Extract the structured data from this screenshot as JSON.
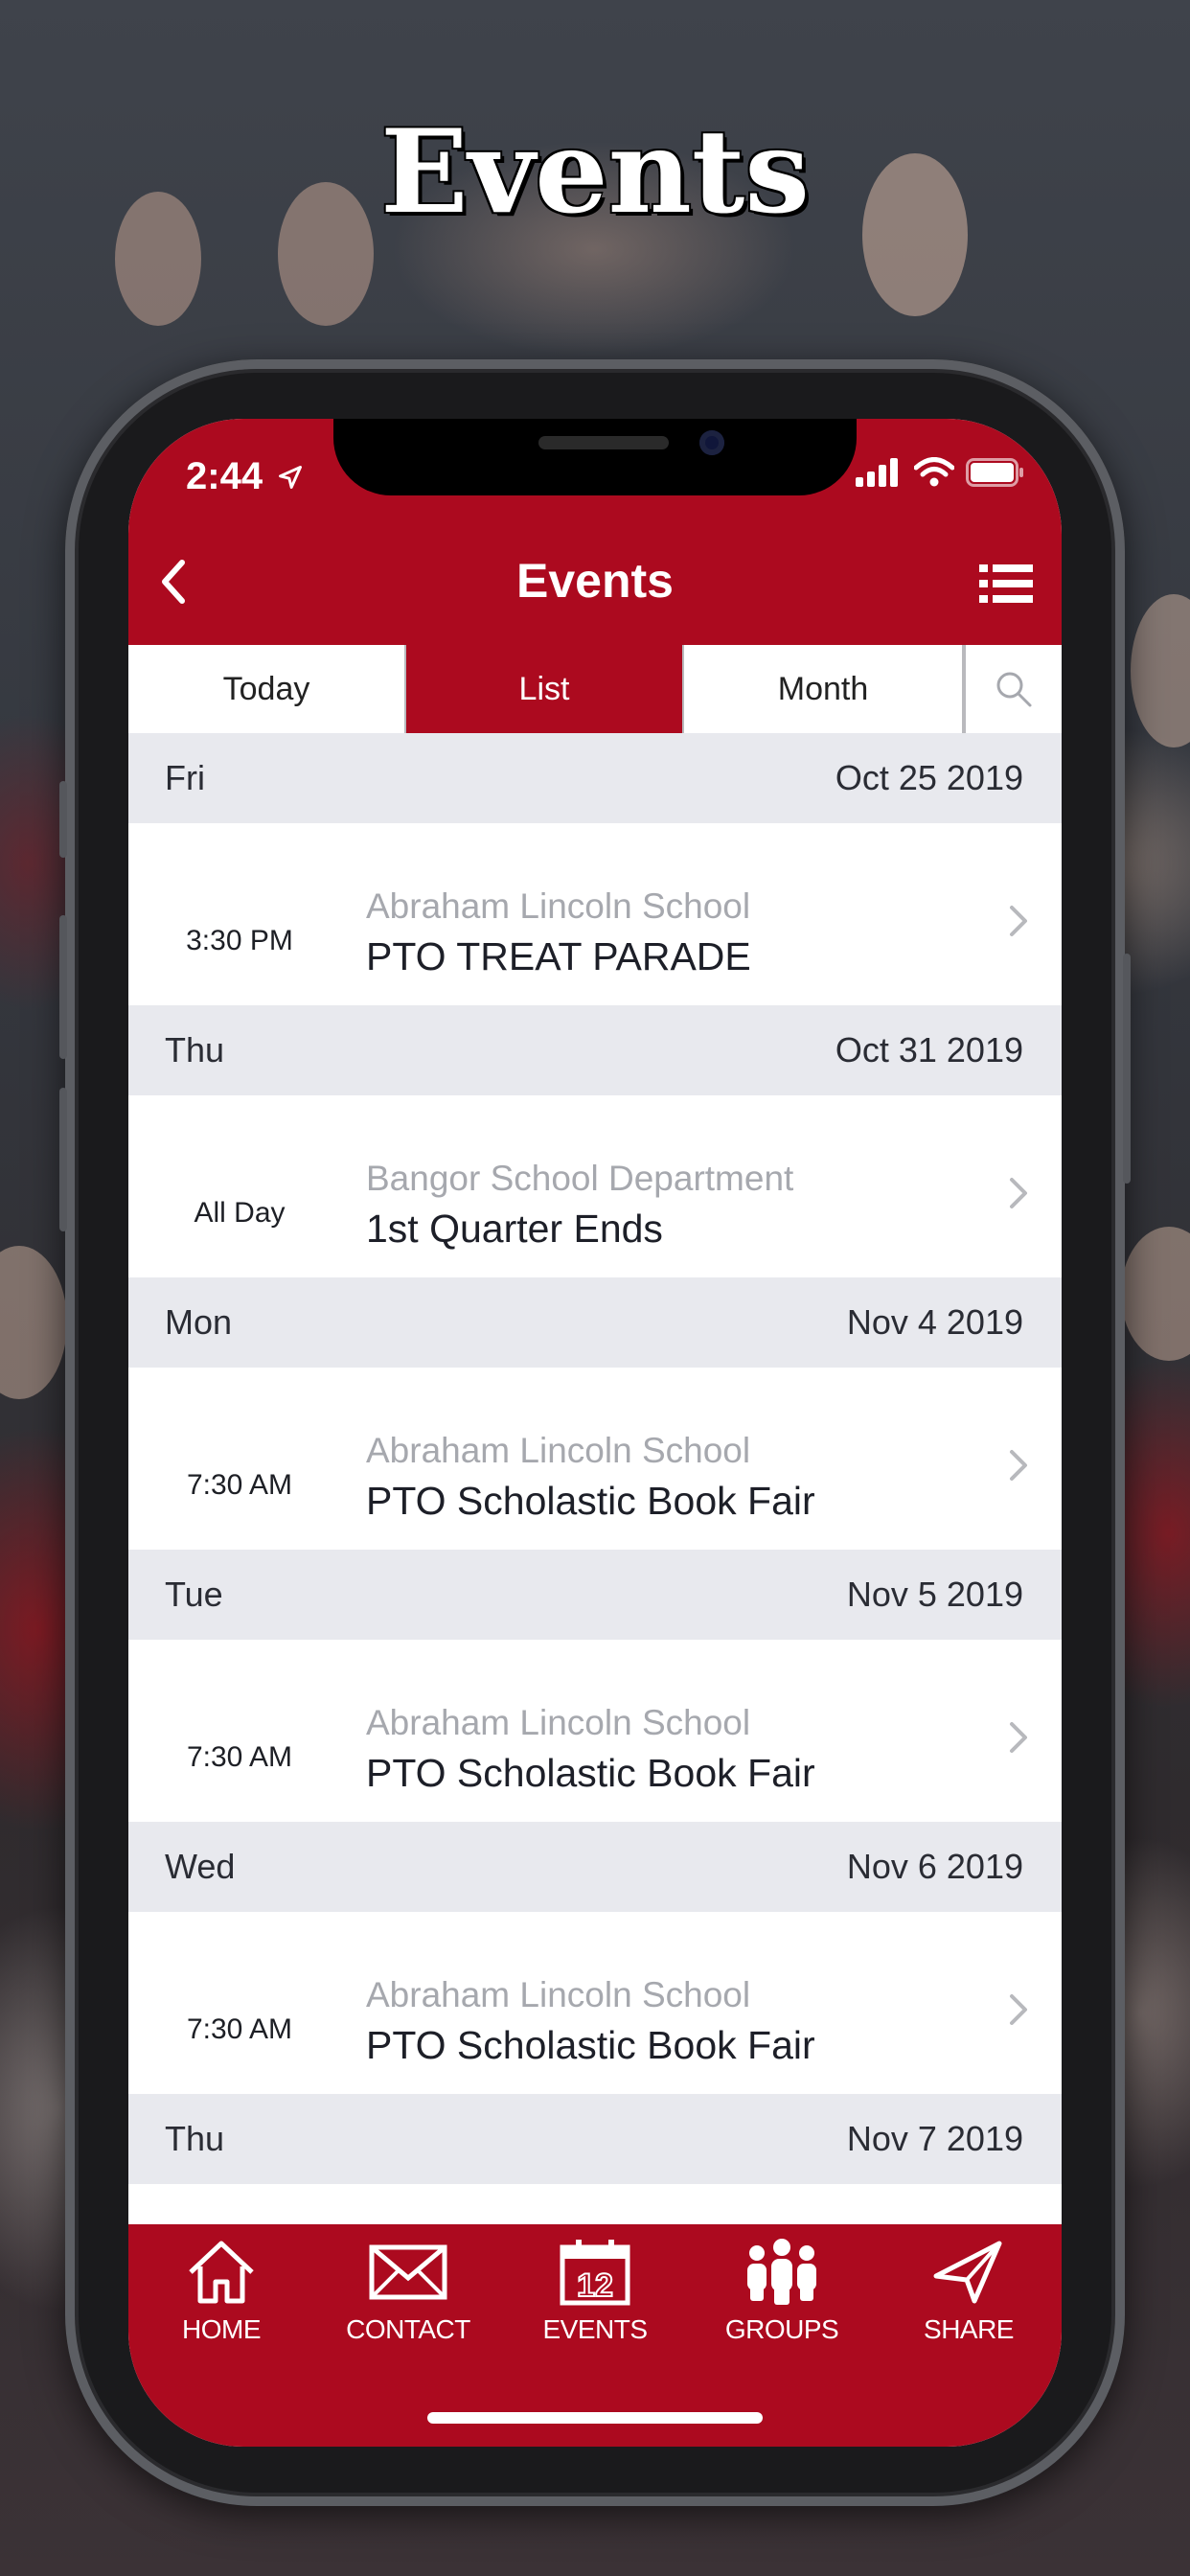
{
  "page": {
    "title": "Events"
  },
  "status_bar": {
    "time": "2:44"
  },
  "nav": {
    "title": "Events"
  },
  "segments": [
    {
      "label": "Today",
      "active": false
    },
    {
      "label": "List",
      "active": true
    },
    {
      "label": "Month",
      "active": false
    }
  ],
  "days": [
    {
      "weekday": "Fri",
      "date": "Oct 25 2019",
      "events": [
        {
          "time": "3:30 PM",
          "org": "Abraham Lincoln School",
          "name": "PTO TREAT PARADE"
        }
      ]
    },
    {
      "weekday": "Thu",
      "date": "Oct 31 2019",
      "events": [
        {
          "time": "All Day",
          "org": "Bangor School Department",
          "name": "1st Quarter Ends"
        }
      ]
    },
    {
      "weekday": "Mon",
      "date": "Nov 4 2019",
      "events": [
        {
          "time": "7:30 AM",
          "org": "Abraham Lincoln School",
          "name": "PTO Scholastic Book Fair"
        }
      ]
    },
    {
      "weekday": "Tue",
      "date": "Nov 5 2019",
      "events": [
        {
          "time": "7:30 AM",
          "org": "Abraham Lincoln School",
          "name": "PTO Scholastic Book Fair"
        }
      ]
    },
    {
      "weekday": "Wed",
      "date": "Nov 6 2019",
      "events": [
        {
          "time": "7:30 AM",
          "org": "Abraham Lincoln School",
          "name": "PTO Scholastic Book Fair"
        }
      ]
    },
    {
      "weekday": "Thu",
      "date": "Nov 7 2019",
      "events": []
    }
  ],
  "tabbar": [
    {
      "label": "HOME",
      "icon": "home-icon"
    },
    {
      "label": "CONTACT",
      "icon": "envelope-icon"
    },
    {
      "label": "EVENTS",
      "icon": "calendar-icon",
      "icon_text": "12"
    },
    {
      "label": "GROUPS",
      "icon": "groups-icon"
    },
    {
      "label": "SHARE",
      "icon": "share-icon"
    }
  ],
  "colors": {
    "brand": "#ac0a1f",
    "day_header_bg": "#e8e9ee",
    "org_text": "#a6a8ae"
  }
}
